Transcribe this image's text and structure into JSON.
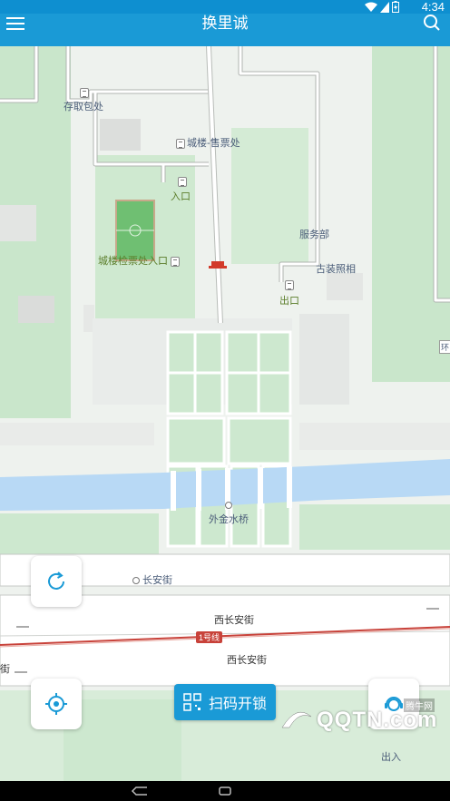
{
  "status_bar": {
    "time": "4:34",
    "icons": [
      "wifi-icon",
      "signal-icon",
      "battery-icon"
    ]
  },
  "app_bar": {
    "title": "换里诚",
    "menu_icon": "menu-icon",
    "search_icon": "search-icon"
  },
  "map": {
    "labels": {
      "baggage": "存取包处",
      "ticket_office": "城楼-售票处",
      "entrance": "入口",
      "service": "服务部",
      "photo": "古装照相",
      "exit": "出口",
      "ticket_check": "城楼检票处入口",
      "bridge": "外金水桥",
      "changan_st": "长安街",
      "west_changan_upper": "西长安街",
      "west_changan_lower": "西长安街",
      "line1": "1号线",
      "edge_left": "街",
      "edge_right": "环",
      "bottom_right": "出入"
    }
  },
  "controls": {
    "refresh_icon": "refresh-icon",
    "locate_icon": "locate-icon",
    "service_icon": "customer-service-icon",
    "scan_label": "扫码开锁",
    "scan_icon": "qr-scan-icon"
  },
  "watermark": {
    "brand": "QQTN.com",
    "sub": "腾牛网"
  },
  "colors": {
    "primary": "#1a9ad6",
    "water": "#b8d9f5",
    "green_area": "#cde8cf",
    "subway": "#c8423a"
  }
}
